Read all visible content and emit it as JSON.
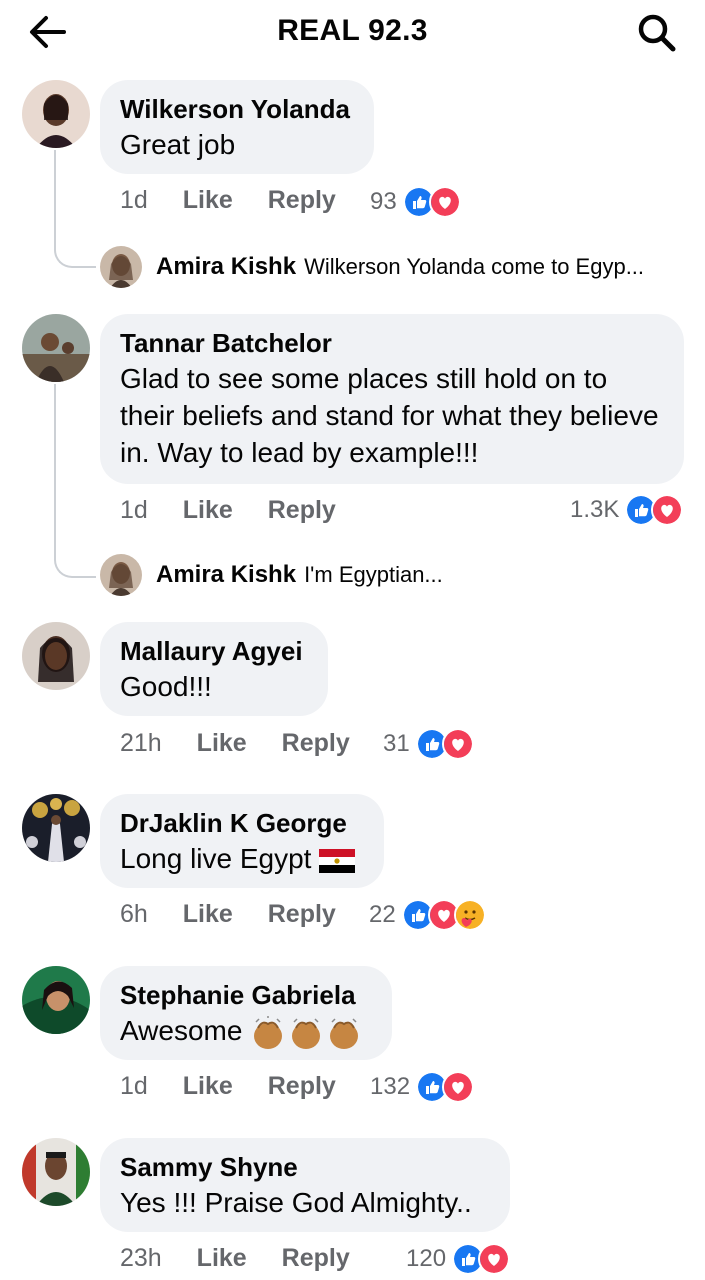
{
  "header": {
    "title": "REAL 92.3",
    "back_icon": "arrow-left-icon",
    "search_icon": "search-icon"
  },
  "comments": [
    {
      "author": "Wilkerson Yolanda",
      "text": "Great job",
      "time": "1d",
      "like": "Like",
      "reply": "Reply",
      "reactions": "93",
      "reply_preview": {
        "author": "Amira Kishk",
        "text": "Wilkerson Yolanda come to Egyp..."
      }
    },
    {
      "author": "Tannar Batchelor",
      "text": "Glad to see some places still hold on to their beliefs and stand for what they believe in. Way to lead by example!!!",
      "time": "1d",
      "like": "Like",
      "reply": "Reply",
      "reactions": "1.3K",
      "reply_preview": {
        "author": "Amira Kishk",
        "text": "I'm Egyptian..."
      }
    },
    {
      "author": "Mallaury Agyei",
      "text": "Good!!!",
      "time": "21h",
      "like": "Like",
      "reply": "Reply",
      "reactions": "31"
    },
    {
      "author": "DrJaklin K George",
      "text": "Long live Egypt",
      "emoji": "egypt-flag-icon",
      "time": "6h",
      "like": "Like",
      "reply": "Reply",
      "reactions": "22"
    },
    {
      "author": "Stephanie Gabriela",
      "text": "Awesome",
      "emoji": "clapping-hands-icon",
      "time": "1d",
      "like": "Like",
      "reply": "Reply",
      "reactions": "132"
    },
    {
      "author": "Sammy Shyne",
      "text": "Yes !!! Praise God Almighty..",
      "time": "23h",
      "like": "Like",
      "reply": "Reply",
      "reactions": "120"
    }
  ],
  "colors": {
    "bubble": "#f0f2f5",
    "like_blue": "#1877f2",
    "love_red": "#f33e58",
    "meta_gray": "#65676b"
  }
}
